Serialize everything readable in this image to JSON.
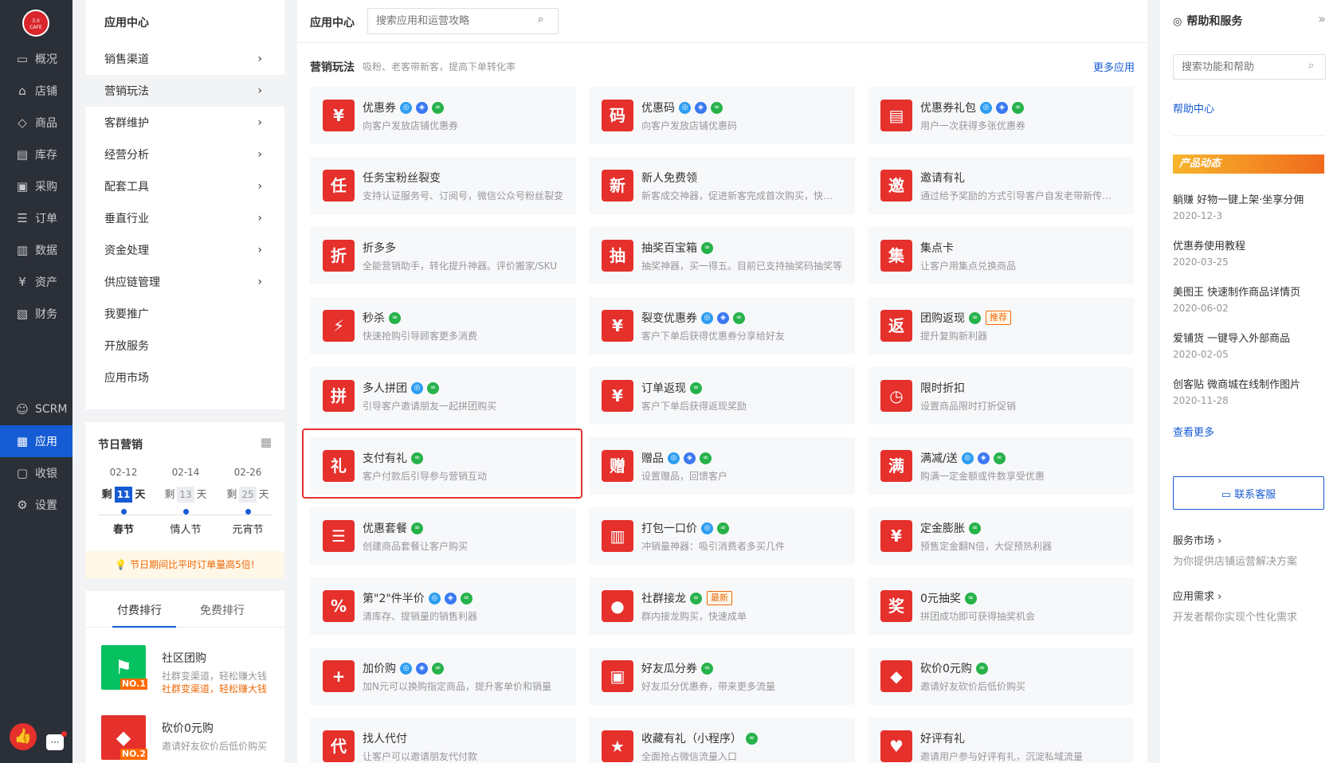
{
  "nav": {
    "logo_line1": "3.0",
    "logo_line2": "CAFE",
    "items": [
      {
        "label": "概况",
        "icon": "monitor-icon",
        "glyph": "▭"
      },
      {
        "label": "店铺",
        "icon": "store-icon",
        "glyph": "⌂"
      },
      {
        "label": "商品",
        "icon": "tag-icon",
        "glyph": "◇"
      },
      {
        "label": "库存",
        "icon": "warehouse-icon",
        "glyph": "▤"
      },
      {
        "label": "采购",
        "icon": "purchase-icon",
        "glyph": "▣"
      },
      {
        "label": "订单",
        "icon": "order-icon",
        "glyph": "☰"
      },
      {
        "label": "数据",
        "icon": "chart-icon",
        "glyph": "▥"
      },
      {
        "label": "资产",
        "icon": "yen-icon",
        "glyph": "¥"
      },
      {
        "label": "财务",
        "icon": "finance-icon",
        "glyph": "▧"
      }
    ],
    "lower_items": [
      {
        "label": "SCRM",
        "icon": "user-icon",
        "glyph": "☺"
      },
      {
        "label": "应用",
        "icon": "apps-icon",
        "glyph": "▦"
      },
      {
        "label": "收银",
        "icon": "cashier-icon",
        "glyph": "▢"
      },
      {
        "label": "设置",
        "icon": "gear-icon",
        "glyph": "⚙"
      }
    ]
  },
  "submenu": {
    "title": "应用中心",
    "items": [
      {
        "label": "销售渠道",
        "chevron": true
      },
      {
        "label": "营销玩法",
        "chevron": true
      },
      {
        "label": "客群维护",
        "chevron": true
      },
      {
        "label": "经营分析",
        "chevron": true
      },
      {
        "label": "配套工具",
        "chevron": true
      },
      {
        "label": "垂直行业",
        "chevron": true
      },
      {
        "label": "资金处理",
        "chevron": true
      },
      {
        "label": "供应链管理",
        "chevron": true
      },
      {
        "label": "我要推广",
        "chevron": false
      },
      {
        "label": "开放服务",
        "chevron": false
      },
      {
        "label": "应用市场",
        "chevron": false
      }
    ]
  },
  "festival": {
    "title": "节日营销",
    "tip": "节日期间比平时订单量高5倍!",
    "remain": "剩",
    "day": "天",
    "cols": [
      {
        "date": "02-12",
        "days": "11",
        "name": "春节"
      },
      {
        "date": "02-14",
        "days": "13",
        "name": "情人节"
      },
      {
        "date": "02-26",
        "days": "25",
        "name": "元宵节"
      }
    ]
  },
  "ranking": {
    "tab_paid": "付费排行",
    "tab_free": "免费排行",
    "items": [
      {
        "name": "社区团购",
        "desc": "社群变渠道，轻松赚大钱",
        "desc2": "社群变渠道，轻松赚大钱",
        "no": "NO.1"
      },
      {
        "name": "砍价0元购",
        "desc": "邀请好友砍价后低价购买",
        "no": "NO.2"
      }
    ]
  },
  "main": {
    "title": "应用中心",
    "search_placeholder": "搜索应用和运营攻略",
    "section_title": "营销玩法",
    "section_sub": "吸粉、老客带新客，提高下单转化率",
    "more": "更多应用",
    "cards": [
      {
        "ico": "¥",
        "icon": "coupon-icon",
        "name": "优惠券",
        "desc": "向客户发放店铺优惠券",
        "badges": [
          "b",
          "i",
          "g"
        ]
      },
      {
        "ico": "码",
        "icon": "code-icon",
        "name": "优惠码",
        "desc": "向客户发放店铺优惠码",
        "badges": [
          "b",
          "i",
          "g"
        ]
      },
      {
        "ico": "▤",
        "icon": "gift-pack-icon",
        "name": "优惠券礼包",
        "desc": "用户一次获得多张优惠券",
        "badges": [
          "b",
          "i",
          "g"
        ]
      },
      {
        "ico": "任",
        "icon": "task-icon",
        "name": "任务宝粉丝裂变",
        "desc": "支持认证服务号、订阅号，微信公众号粉丝裂变",
        "badges": []
      },
      {
        "ico": "新",
        "icon": "new-icon",
        "name": "新人免费领",
        "desc": "新客成交神器，促进新客完成首次购买，快速提升",
        "badges": []
      },
      {
        "ico": "邀",
        "icon": "invite-icon",
        "name": "邀请有礼",
        "desc": "通过给予奖励的方式引导客户自发老带新传播店铺",
        "badges": []
      },
      {
        "ico": "折",
        "icon": "discount-icon",
        "name": "折多多",
        "desc": "全能营销助手，转化提升神器。评价搬家/SKU",
        "badges": []
      },
      {
        "ico": "抽",
        "icon": "lottery-icon",
        "name": "抽奖百宝箱",
        "desc": "抽奖神器，买一得五。目前已支持抽奖码抽奖等",
        "badges": [
          "g"
        ]
      },
      {
        "ico": "集",
        "icon": "collect-icon",
        "name": "集点卡",
        "desc": "让客户用集点兑换商品",
        "badges": []
      },
      {
        "ico": "⚡",
        "icon": "flash-icon",
        "name": "秒杀",
        "desc": "快速抢购引导顾客更多消费",
        "badges": [
          "g"
        ]
      },
      {
        "ico": "¥",
        "icon": "split-coupon-icon",
        "name": "裂变优惠券",
        "desc": "客户下单后获得优惠券分享给好友",
        "badges": [
          "b",
          "i",
          "g"
        ]
      },
      {
        "ico": "返",
        "icon": "rebate-icon",
        "name": "团购返现",
        "desc": "提升复购新利器",
        "badges": [
          "g"
        ],
        "tag": "推荐"
      },
      {
        "ico": "拼",
        "icon": "group-buy-icon",
        "name": "多人拼团",
        "desc": "引导客户邀请朋友一起拼团购买",
        "badges": [
          "b",
          "g"
        ]
      },
      {
        "ico": "¥",
        "icon": "order-rebate-icon",
        "name": "订单返现",
        "desc": "客户下单后获得返现奖励",
        "badges": [
          "g"
        ]
      },
      {
        "ico": "◷",
        "icon": "clock-icon",
        "name": "限时折扣",
        "desc": "设置商品限时打折促销",
        "badges": []
      },
      {
        "ico": "礼",
        "icon": "pay-gift-icon",
        "name": "支付有礼",
        "desc": "客户付款后引导参与营销互动",
        "badges": [
          "g"
        ]
      },
      {
        "ico": "赠",
        "icon": "giveaway-icon",
        "name": "赠品",
        "desc": "设置赠品，回馈客户",
        "badges": [
          "b",
          "i",
          "g"
        ]
      },
      {
        "ico": "满",
        "icon": "full-reduce-icon",
        "name": "满减/送",
        "desc": "购满一定金额或件数享受优惠",
        "badges": [
          "b",
          "i",
          "g"
        ]
      },
      {
        "ico": "☰",
        "icon": "package-icon",
        "name": "优惠套餐",
        "desc": "创建商品套餐让客户购买",
        "badges": [
          "g"
        ]
      },
      {
        "ico": "▥",
        "icon": "basket-icon",
        "name": "打包一口价",
        "desc": "冲销量神器：吸引消费者多买几件",
        "badges": [
          "b",
          "g"
        ]
      },
      {
        "ico": "¥",
        "icon": "deposit-icon",
        "name": "定金膨胀",
        "desc": "预售定金翻N倍，大促预热利器",
        "badges": [
          "g"
        ]
      },
      {
        "ico": "%",
        "icon": "half-price-icon",
        "name": "第\"2\"件半价",
        "desc": "清库存、提销量的销售利器",
        "badges": [
          "b",
          "i",
          "g"
        ]
      },
      {
        "ico": "●",
        "icon": "chat-icon",
        "name": "社群接龙",
        "desc": "群内接龙购买，快速成单",
        "badges": [
          "g"
        ],
        "tag": "最新"
      },
      {
        "ico": "奖",
        "icon": "zero-lottery-icon",
        "name": "0元抽奖",
        "desc": "拼团成功即可获得抽奖机会",
        "badges": [
          "g"
        ]
      },
      {
        "ico": "+",
        "icon": "addon-icon",
        "name": "加价购",
        "desc": "加N元可以换购指定商品，提升客单价和销量",
        "badges": [
          "b",
          "i",
          "g"
        ]
      },
      {
        "ico": "▣",
        "icon": "friend-share-icon",
        "name": "好友瓜分券",
        "desc": "好友瓜分优惠券，带来更多流量",
        "badges": [
          "g"
        ]
      },
      {
        "ico": "◆",
        "icon": "bargain-icon",
        "name": "砍价0元购",
        "desc": "邀请好友砍价后低价购买",
        "badges": [
          "g"
        ]
      },
      {
        "ico": "代",
        "icon": "proxy-pay-icon",
        "name": "找人代付",
        "desc": "让客户可以邀请朋友代付款",
        "badges": []
      },
      {
        "ico": "★",
        "icon": "favorite-icon",
        "name": "收藏有礼（小程序）",
        "desc": "全面抢占微信流量入口",
        "badges": [
          "g"
        ]
      },
      {
        "ico": "♥",
        "icon": "review-icon",
        "name": "好评有礼",
        "desc": "邀请用户参与好评有礼，沉淀私域流量",
        "badges": []
      }
    ]
  },
  "help": {
    "title": "帮助和服务",
    "search_placeholder": "搜索功能和帮助",
    "help_center": "帮助中心",
    "banner": "产品动态",
    "news": [
      {
        "title": "躺赚 好物一键上架·坐享分佣",
        "date": "2020-12-3"
      },
      {
        "title": "优惠券使用教程",
        "date": "2020-03-25"
      },
      {
        "title": "美图王 快速制作商品详情页",
        "date": "2020-06-02"
      },
      {
        "title": "爱铺货 一键导入外部商品",
        "date": "2020-02-05"
      },
      {
        "title": "创客贴 微商城在线制作图片",
        "date": "2020-11-28"
      }
    ],
    "see_more": "查看更多",
    "contact": "联系客服",
    "service_market": "服务市场 ›",
    "service_market_desc": "为你提供店铺运营解决方案",
    "app_demand": "应用需求 ›",
    "app_demand_desc": "开发者帮你实现个性化需求"
  }
}
